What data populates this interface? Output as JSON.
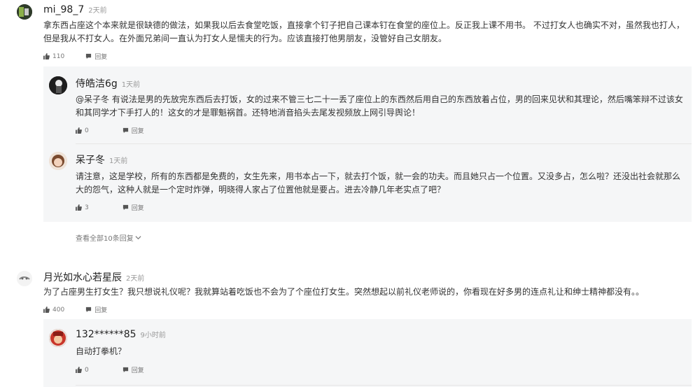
{
  "comments": [
    {
      "user": "mi_98_7",
      "time": "2天前",
      "text": "拿东西占座这个本来就是很缺德的做法，如果我以后去食堂吃饭，直接拿个钉子把自己课本钉在食堂的座位上。反正我上课不用书。 不过打女人也确实不对，虽然我也打人，但是我从不打女人。在外面兄弟间一直认为打女人是懦夫的行为。应该直接打他男朋友，没管好自己女朋友。",
      "likes": "110",
      "reply_label": "回复",
      "replies": [
        {
          "user": "侍皓洁6g",
          "time": "1天前",
          "text": "@呆子冬 有说法是男的先放完东西后去打饭，女的过来不管三七二十一丢了座位上的东西然后用自己的东西放着占位，男的回来见状和其理论，然后嘴笨辩不过该女和其同学才下手打人的！这女的才是罪魁祸首。还特地消音掐头去尾发视频放上网引导舆论！",
          "likes": "0",
          "reply_label": "回复"
        },
        {
          "user": "呆子冬",
          "time": "1天前",
          "text": "请注意，这是学校，所有的东西都是免费的，女生先来，用书本占一下，就去打个饭，就一会的功夫。而且她只占一个位置。又没多占，怎么啦？还没出社会就那么大的怨气，这种人就是一个定时炸弹，明晓得人家占了位置他就是要占。进去冷静几年老实点了吧？",
          "likes": "3",
          "reply_label": "回复"
        }
      ],
      "more_replies": "查看全部10条回复"
    },
    {
      "user": "月光如水心若星辰",
      "time": "2天前",
      "text": "为了占座男生打女生？我只想说礼仪呢？我就算站着吃饭也不会为了个座位打女生。突然想起以前礼仪老师说的，你看现在好多男的连点礼让和绅士精神都没有。。",
      "likes": "400",
      "reply_label": "回复",
      "replies": [
        {
          "user": "132******85",
          "time": "9小时前",
          "text": "自动打拳机？",
          "likes": "0",
          "reply_label": "回复"
        }
      ]
    }
  ],
  "icons": {
    "like": "thumbs-up-icon",
    "reply": "speech-bubble-icon",
    "expand": "chevron-down-icon"
  },
  "colors": {
    "reply_bg": "#f5f6f7",
    "meta": "#999999",
    "text": "#333333"
  }
}
